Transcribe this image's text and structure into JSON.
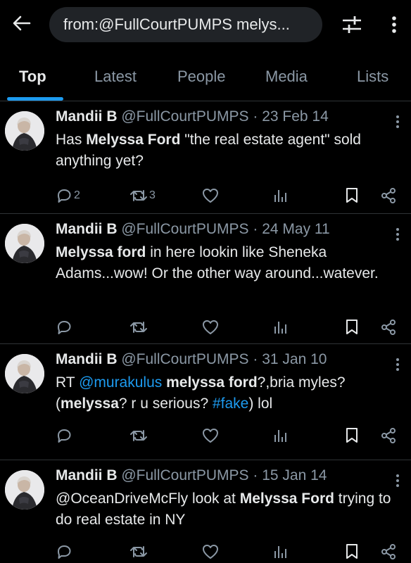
{
  "header": {
    "search_query": "from:@FullCourtPUMPS melys..."
  },
  "tabs": [
    {
      "label": "Top"
    },
    {
      "label": "Latest"
    },
    {
      "label": "People"
    },
    {
      "label": "Media"
    },
    {
      "label": "Lists"
    }
  ],
  "tweets": [
    {
      "name": "Mandii B",
      "handle": "@FullCourtPUMPS",
      "separator": "·",
      "date": "23 Feb 14",
      "body": [
        {
          "t": "Has "
        },
        {
          "t": "Melyssa Ford",
          "b": true
        },
        {
          "t": " \"the real estate agent\" sold anything yet?"
        }
      ],
      "replies": "2",
      "retweets": "3"
    },
    {
      "name": "Mandii B",
      "handle": "@FullCourtPUMPS",
      "separator": "·",
      "date": "24 May 11",
      "body": [
        {
          "t": "Melyssa ford",
          "b": true
        },
        {
          "t": " in here lookin like Sheneka Adams...wow! Or the other way around...watever."
        }
      ],
      "replies": "",
      "retweets": ""
    },
    {
      "name": "Mandii B",
      "handle": "@FullCourtPUMPS",
      "separator": "·",
      "date": "31 Jan 10",
      "body": [
        {
          "t": "RT "
        },
        {
          "t": "@murakulus",
          "link": true
        },
        {
          "t": "   "
        },
        {
          "t": "melyssa ford",
          "b": true
        },
        {
          "t": "?,bria myles? ("
        },
        {
          "t": "melyssa",
          "b": true
        },
        {
          "t": "? r u serious? "
        },
        {
          "t": "#fake",
          "link": true
        },
        {
          "t": ") lol"
        }
      ],
      "replies": "",
      "retweets": ""
    },
    {
      "name": "Mandii B",
      "handle": "@FullCourtPUMPS",
      "separator": "·",
      "date": "15 Jan 14",
      "body": [
        {
          "t": "@OceanDriveMcFly look at "
        },
        {
          "t": "Melyssa Ford",
          "b": true
        },
        {
          "t": " trying to do real estate in NY"
        }
      ],
      "replies": "",
      "retweets": ""
    }
  ],
  "icons": {
    "back": "arrow-left-icon",
    "filter": "sliders-icon",
    "more": "more-vertical-icon",
    "reply": "speech-bubble-icon",
    "retweet": "retweet-icon",
    "like": "heart-icon",
    "views": "bar-chart-icon",
    "bookmark": "bookmark-icon",
    "share": "share-icon"
  },
  "colors": {
    "background": "#000000",
    "accent": "#1d9bf0",
    "text": "#e7e9ea",
    "muted": "#8b98a5",
    "divider": "#2f3336"
  }
}
